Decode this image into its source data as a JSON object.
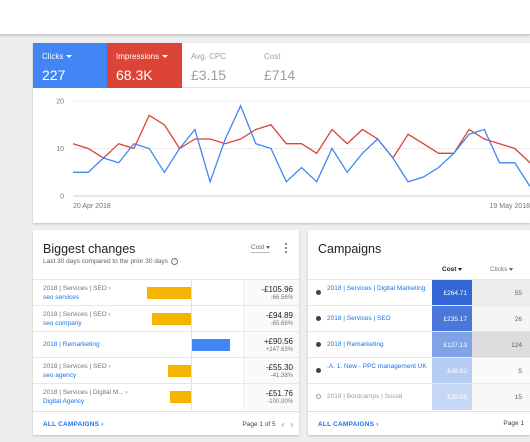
{
  "overview": {
    "tiles": [
      {
        "label": "Clicks",
        "value": "227"
      },
      {
        "label": "Impressions",
        "value": "68.3K"
      },
      {
        "label": "Avg. CPC",
        "value": "£3.15"
      },
      {
        "label": "Cost",
        "value": "£714"
      }
    ],
    "colors": {
      "clicks": "#4285f4",
      "impressions": "#db4437"
    }
  },
  "chart_data": {
    "type": "line",
    "yticks": [
      "20",
      "10",
      "0"
    ],
    "ylim": [
      0,
      20
    ],
    "x_start_label": "20 Apr 2018",
    "x_end_label": "19 May 2018",
    "series": [
      {
        "name": "Clicks",
        "color": "#4285f4",
        "values": [
          5,
          5,
          8,
          7,
          11,
          10,
          5,
          10,
          14,
          3,
          12,
          19,
          11,
          10,
          3,
          6,
          3,
          10,
          5,
          9,
          12,
          8,
          3,
          4,
          6,
          9,
          13,
          14,
          7,
          7,
          2
        ]
      },
      {
        "name": "Impressions",
        "color": "#db4437",
        "values": [
          11,
          10,
          8,
          11,
          10,
          17,
          15,
          10,
          12,
          12,
          11,
          12,
          14,
          15,
          11,
          11,
          9,
          14,
          11,
          14,
          12,
          8,
          13,
          11,
          9,
          9,
          14,
          12,
          11,
          10,
          7
        ]
      }
    ]
  },
  "biggest_changes": {
    "title": "Biggest changes",
    "subtitle": "Last 30 days compared to the prior 30 days",
    "metric": "Cost",
    "rows": [
      {
        "path": "2018 | Services | SEO ›",
        "link": "seo services",
        "value": "-£105.96",
        "pct": "-66.56%",
        "change": -105.96
      },
      {
        "path": "2018 | Services | SEO ›",
        "link": "seo company",
        "value": "-£94.89",
        "pct": "-65.66%",
        "change": -94.89
      },
      {
        "path": "",
        "link": "2018 | Remarketing",
        "value": "+£90.56",
        "pct": "+247.63%",
        "change": 90.56
      },
      {
        "path": "2018 | Services | SEO ›",
        "link": "seo agency",
        "value": "-£55.30",
        "pct": "-41.38%",
        "change": -55.3
      },
      {
        "path": "2018 | Services | Digital M... ›",
        "link": "Digital Agency",
        "value": "-£51.76",
        "pct": "-100.00%",
        "change": -51.76
      }
    ],
    "footer_link": "ALL CAMPAIGNS",
    "pager": "Page 1 of 5"
  },
  "campaigns": {
    "title": "Campaigns",
    "col_cost": "Cost",
    "col_clicks": "Clicks",
    "rows": [
      {
        "name": "2018 | Services | Digital Marketing",
        "cost": "£264.71",
        "clicks": "55",
        "enabled": true,
        "cost_color": "#3367d6",
        "clicks_color": "#ececec"
      },
      {
        "name": "2018 | Services | SEO",
        "cost": "£235.17",
        "clicks": "26",
        "enabled": true,
        "cost_color": "#4a78da",
        "clicks_color": "#f5f5f5"
      },
      {
        "name": "2018 | Remarketing",
        "cost": "£127.13",
        "clicks": "124",
        "enabled": true,
        "cost_color": "#7fa3e6",
        "clicks_color": "#dcdcdc"
      },
      {
        "name": ".A. 1. New - PPC management UK",
        "cost": "£48.82",
        "clicks": "5",
        "enabled": true,
        "cost_color": "#b7ccf2",
        "clicks_color": "#fafafa"
      },
      {
        "name": "2018 | Bootcamps | Social",
        "cost": "£30.08",
        "clicks": "15",
        "enabled": false,
        "cost_color": "#c6d7f5",
        "clicks_color": "#f7f7f7"
      }
    ],
    "footer_link": "ALL CAMPAIGNS",
    "pager": "Page 1"
  }
}
